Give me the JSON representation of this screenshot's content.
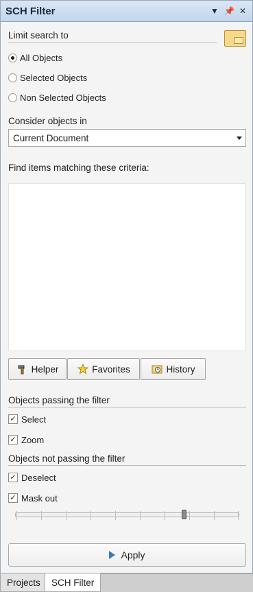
{
  "panel": {
    "title": "SCH Filter",
    "controls": {
      "menu_icon": "dropdown-arrow-icon",
      "pin_icon": "pin-icon",
      "close_icon": "close-icon"
    }
  },
  "limit_search": {
    "label": "Limit search to",
    "options": [
      {
        "label": "All Objects",
        "checked": true
      },
      {
        "label": "Selected Objects",
        "checked": false
      },
      {
        "label": "Non Selected Objects",
        "checked": false
      }
    ]
  },
  "consider": {
    "label": "Consider objects in",
    "selected": "Current Document"
  },
  "criteria": {
    "label": "Find items matching these criteria:",
    "text": ""
  },
  "buttons": {
    "helper": "Helper",
    "favorites": "Favorites",
    "history": "History"
  },
  "passing": {
    "label": "Objects passing the filter",
    "options": [
      {
        "label": "Select",
        "checked": true
      },
      {
        "label": "Zoom",
        "checked": true
      }
    ]
  },
  "not_passing": {
    "label": "Objects not passing the filter",
    "options": [
      {
        "label": "Deselect",
        "checked": true
      },
      {
        "label": "Mask out",
        "checked": true
      }
    ]
  },
  "mask_slider": {
    "level": 0.76
  },
  "apply": {
    "label": "Apply"
  },
  "tabs": [
    {
      "label": "Projects",
      "active": false
    },
    {
      "label": "SCH Filter",
      "active": true
    }
  ],
  "colors": {
    "title_bg": "#c9d9ee",
    "apply_icon": "#3a78c4",
    "folder_icon": "#f7d98b"
  }
}
